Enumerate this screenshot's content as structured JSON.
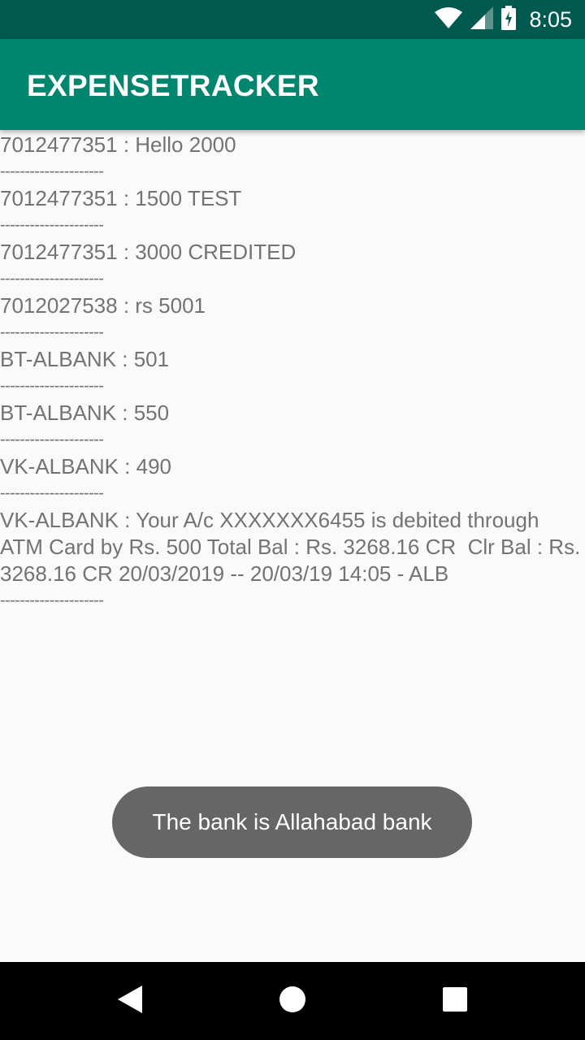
{
  "status_bar": {
    "time": "8:05",
    "icons": [
      "wifi-icon",
      "cell-signal-icon",
      "battery-charging-icon"
    ]
  },
  "app_bar": {
    "title": "EXPENSETRACKER"
  },
  "messages": [
    {
      "text": "7012477351 : Hello 2000"
    },
    {
      "text": "7012477351 : 1500 TEST"
    },
    {
      "text": "7012477351 : 3000 CREDITED"
    },
    {
      "text": "7012027538 : rs 5001"
    },
    {
      "text": "BT-ALBANK : 501"
    },
    {
      "text": "BT-ALBANK : 550"
    },
    {
      "text": "VK-ALBANK : 490"
    },
    {
      "text": "VK-ALBANK : Your A/c XXXXXXX6455 is debited through ATM Card by Rs. 500 Total Bal : Rs. 3268.16 CR  Clr Bal : Rs. 3268.16 CR 20/03/2019 -- 20/03/19 14:05 - ALB"
    }
  ],
  "separator": "---------------------",
  "toast": {
    "text": "The bank is Allahabad bank"
  },
  "nav_bar": {
    "buttons": [
      "back-icon",
      "home-icon",
      "recents-icon"
    ]
  },
  "colors": {
    "status_bar": "#00594e",
    "app_bar": "#00866f",
    "background": "#fafafa",
    "text": "#737373",
    "toast": "#666666"
  }
}
